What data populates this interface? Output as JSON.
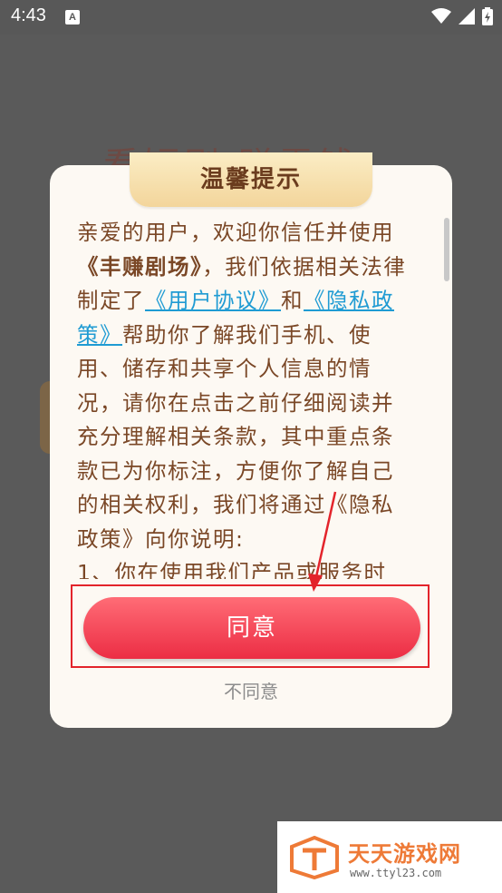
{
  "status_bar": {
    "time": "4:43",
    "notification_icon": "A"
  },
  "background": {
    "title": "看短剧 赚零钱"
  },
  "dialog": {
    "title": "温馨提示",
    "body": {
      "p1": "亲爱的用户，欢迎你信任并使用",
      "app_name": "《丰赚剧场》",
      "p2": "，我们依据相关法律制定了",
      "link_user_agreement": "《用户协议》",
      "p3": "和",
      "link_privacy_policy": "《隐私政策》",
      "p4": "帮助你了解我们手机、使用、储存和共享个人信息的情况，请你在点击之前仔细阅读并充分理解相关条款，其中重点条款已为你标注，方便你了解自己的相关权利，我们将通过《隐私政策》向你说明:",
      "p5": "1、你在使用我们产品或服务时"
    },
    "agree_label": "同意",
    "disagree_label": "不同意"
  },
  "watermark": {
    "title": "天天游戏网",
    "url": "www.ttyl23.com"
  }
}
